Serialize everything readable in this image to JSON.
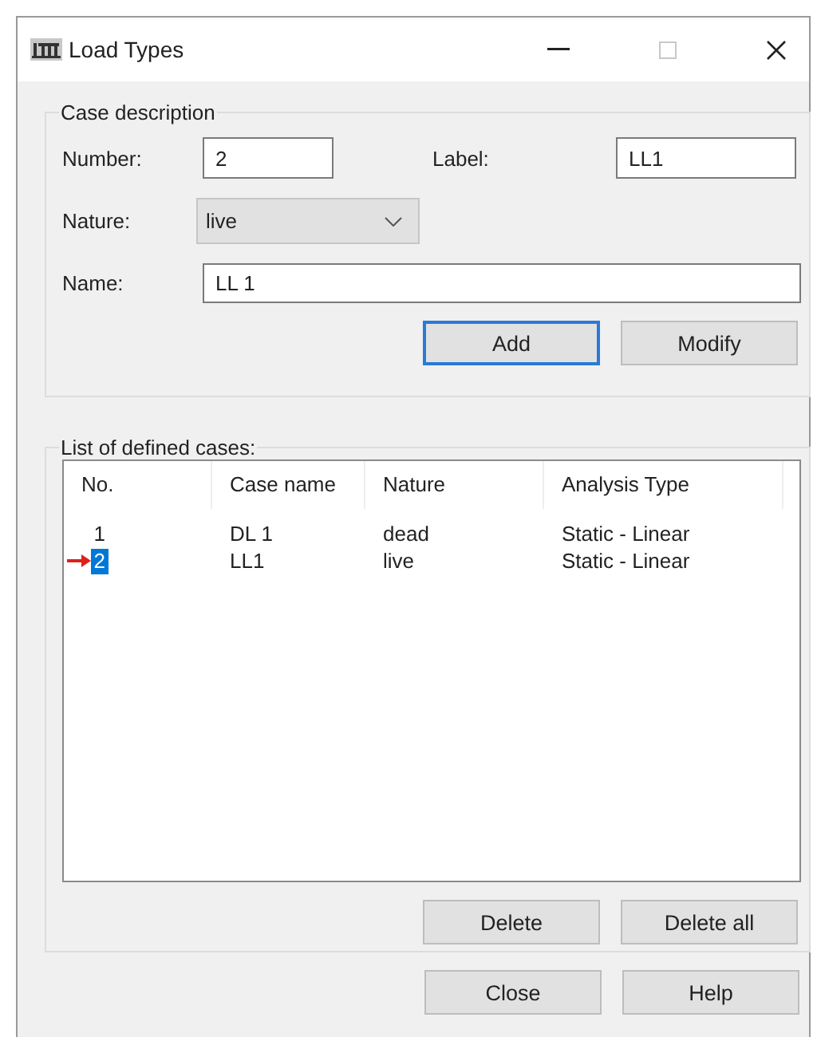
{
  "window": {
    "title": "Load Types"
  },
  "case_description": {
    "title": "Case description",
    "number_label": "Number:",
    "number": "2",
    "label_label": "Label:",
    "label": "LL1",
    "nature_label": "Nature:",
    "nature": "live",
    "name_label": "Name:",
    "name": "LL 1",
    "buttons": [
      {
        "label": "Add",
        "focused": true
      },
      {
        "label": "Modify",
        "focused": false
      }
    ]
  },
  "cases": {
    "title": "List of defined cases:",
    "columns": [
      "No.",
      "Case name",
      "Nature",
      "Analysis Type"
    ],
    "rows": [
      {
        "cells": [
          "1",
          "DL 1",
          "dead",
          "Static - Linear"
        ],
        "selected": false
      },
      {
        "cells": [
          "2",
          "LL1",
          "live",
          "Static - Linear"
        ],
        "selected": true
      }
    ],
    "buttons": [
      "Delete",
      "Delete all"
    ]
  },
  "buttons": [
    "Close",
    "Help"
  ]
}
